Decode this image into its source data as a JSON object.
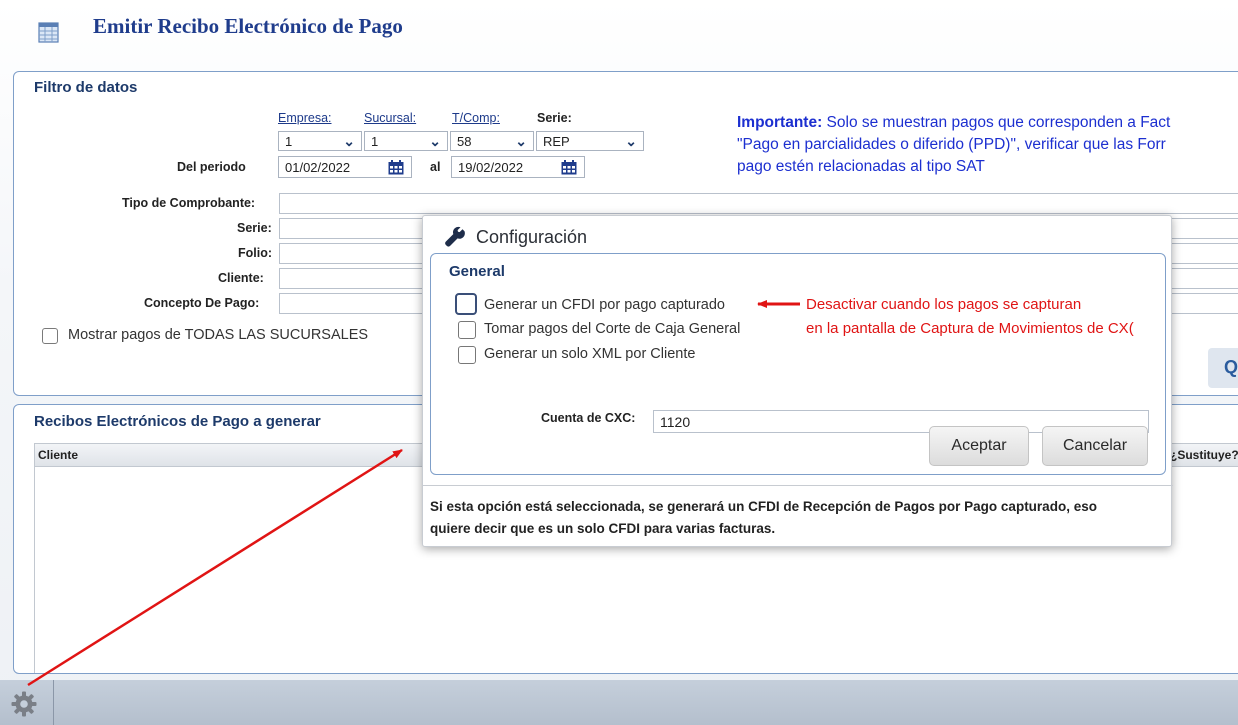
{
  "header": {
    "title": "Emitir Recibo Electrónico de Pago",
    "icon": "table-icon"
  },
  "filter": {
    "title": "Filtro de datos",
    "empresa_label": "Empresa:",
    "sucursal_label": "Sucursal:",
    "tcomp_label": "T/Comp:",
    "serie_label": "Serie:",
    "empresa_value": "1",
    "sucursal_value": "1",
    "tcomp_value": "58",
    "serie_value": "REP",
    "periodo_label": "Del periodo",
    "fecha_desde": "01/02/2022",
    "al_label": "al",
    "fecha_hasta": "19/02/2022",
    "tipo_comprobante_label": "Tipo de Comprobante:",
    "serie_field_label": "Serie:",
    "folio_label": "Folio:",
    "cliente_label": "Cliente:",
    "concepto_label": "Concepto De Pago:",
    "todas_sucursales_label": "Mostrar pagos de TODAS LAS SUCURSALES",
    "important_bold": "Importante:",
    "important_line1": " Solo se muestran pagos que corresponden a Fact",
    "important_line2": "\"Pago en parcialidades o diferido (PPD)\", verificar que las Forr",
    "important_line3": "pago estén relacionadas al tipo SAT",
    "search_button": "Q"
  },
  "recibos": {
    "title": "Recibos Electrónicos de Pago a generar",
    "columns": [
      "Cliente",
      "¿Sustituye?"
    ]
  },
  "dialog": {
    "title": "Configuración",
    "group_title": "General",
    "options": [
      {
        "label": "Generar un CFDI por pago capturado",
        "checked": false
      },
      {
        "label": "Tomar pagos del Corte de Caja General",
        "checked": false
      },
      {
        "label": "Generar un solo XML por Cliente",
        "checked": false
      }
    ],
    "cxc_label": "Cuenta de CXC:",
    "cxc_value": "1120",
    "accept_button": "Aceptar",
    "cancel_button": "Cancelar",
    "help_line1": "Si esta opción está seleccionada, se generará un CFDI de Recepción de Pagos por Pago capturado, eso",
    "help_line2": "quiere decir que es un solo CFDI para varias facturas."
  },
  "annotation": {
    "line1": "Desactivar cuando los pagos se capturan",
    "line2": "en la pantalla de Captura de Movimientos de CX(",
    "color": "#e01414"
  },
  "footer": {
    "icon": "gear-icon"
  }
}
